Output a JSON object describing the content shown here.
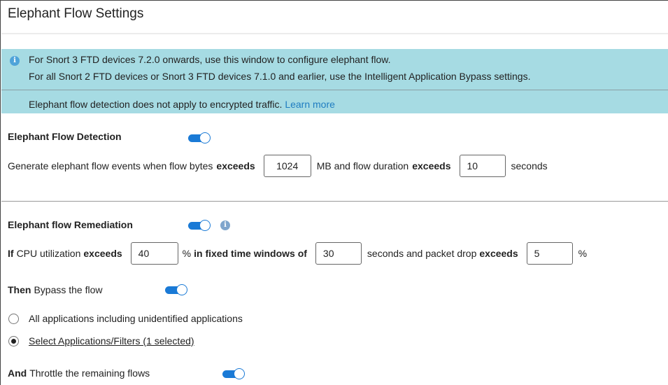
{
  "title": "Elephant Flow Settings",
  "banner": {
    "line1": "For Snort 3 FTD devices 7.2.0 onwards, use this window to configure elephant flow.",
    "line2": "For all Snort 2 FTD devices or Snort 3 FTD devices 7.1.0 and earlier, use the Intelligent Application Bypass settings.",
    "line3": "Elephant flow detection does not apply to encrypted traffic.",
    "learn_more": "Learn more",
    "icon_glyph": "i"
  },
  "detection": {
    "label": "Elephant Flow Detection",
    "enabled": true,
    "text_a": "Generate elephant flow events when flow bytes",
    "text_exceeds1": "exceeds",
    "bytes_value": "1024",
    "text_b": "MB and flow duration",
    "text_exceeds2": "exceeds",
    "duration_value": "10",
    "text_c": "seconds"
  },
  "remediation": {
    "label": "Elephant flow Remediation",
    "enabled": true,
    "info_glyph": "i",
    "if_word": "If",
    "cpu_text": "CPU utilization",
    "exceeds1": "exceeds",
    "cpu_value": "40",
    "pct_text": "%",
    "fixed_text": "in fixed time windows of",
    "window_value": "30",
    "seconds_text": "seconds and packet drop",
    "exceeds2": "exceeds",
    "drop_value": "5",
    "pct_end": "%"
  },
  "bypass": {
    "then_word": "Then",
    "text": "Bypass the flow",
    "enabled": true,
    "option_all": "All applications including unidentified applications",
    "option_select": "Select Applications/Filters (1 selected)",
    "selected_option": "select"
  },
  "throttle": {
    "and_word": "And",
    "text": "Throttle the remaining flows",
    "enabled": true
  },
  "colors": {
    "banner_bg": "#a6dbe3",
    "toggle_on": "#1a7ad6",
    "link": "#1f7dc1"
  }
}
